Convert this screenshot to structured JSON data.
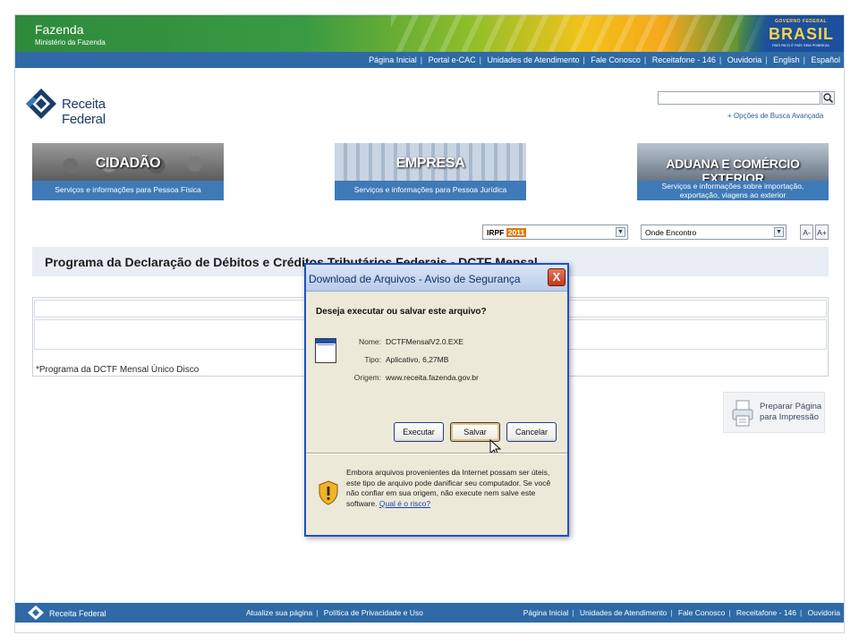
{
  "header": {
    "org_title": "Fazenda",
    "org_subtitle": "Ministério da Fazenda",
    "brasil_top": "GOVERNO FEDERAL",
    "brasil_word": "BRASIL",
    "brasil_bottom": "PAÍS RICO É PAÍS SEM POBREZA"
  },
  "topnav": {
    "items": [
      "Página Inicial",
      "Portal e-CAC",
      "Unidades de Atendimento",
      "Fale Conosco",
      "Receitafone - 146",
      "Ouvidoria",
      "English",
      "Español"
    ]
  },
  "logo": {
    "text": "Receita Federal"
  },
  "search": {
    "value": "",
    "advanced_link": "+ Opções de Busca Avançada"
  },
  "categories": [
    {
      "title": "CIDADÃO",
      "line1": "Serviços e informações para Pessoa Física",
      "line2": ""
    },
    {
      "title": "EMPRESA",
      "line1": "Serviços e informações para Pessoa Jurídica",
      "line2": ""
    },
    {
      "title": "ADUANA E COMÉRCIO EXTERIOR",
      "line1": "Serviços e informações sobre importação,",
      "line2": "exportação, viagens ao exterior"
    }
  ],
  "selects": {
    "irpf_label": "IRPF",
    "irpf_year": "2011",
    "where": "Onde Encontro"
  },
  "font_buttons": {
    "decrease": "A-",
    "increase": "A+"
  },
  "page": {
    "title": "Programa da Declaração de Débitos e Créditos Tributários Federais - DCTF Mensal",
    "row_link": "*Programa da DCTF Mensal Único Disco"
  },
  "print": {
    "line1": "Preparar Página",
    "line2": "para Impressão"
  },
  "footer": {
    "logo_text": "Receita Federal",
    "mid_items": [
      "Atualize sua página",
      "Política de Privacidade e Uso"
    ],
    "right_items": [
      "Página Inicial",
      "Unidades de Atendimento",
      "Fale Conosco",
      "Receitafone - 146",
      "Ouvidoria"
    ]
  },
  "dialog": {
    "title": "Download de Arquivos - Aviso de Segurança",
    "close": "X",
    "question": "Deseja executar ou salvar este arquivo?",
    "name_label": "Nome:",
    "name_value": "DCTFMensalV2.0.EXE",
    "type_label": "Tipo:",
    "type_value": "Aplicativo, 6,27MB",
    "origin_label": "Origem:",
    "origin_value": "www.receita.fazenda.gov.br",
    "btn_run": "Executar",
    "btn_save": "Salvar",
    "btn_cancel": "Cancelar",
    "warning_text": "Embora arquivos provenientes da Internet possam ser úteis, este tipo de arquivo pode danificar seu computador. Se você não confiar em sua origem, não execute nem salve este software.",
    "warning_link": "Qual é o risco?"
  },
  "colors": {
    "nav_blue": "#2f6aa6",
    "dialog_border": "#1c52c8",
    "dialog_bg": "#ece9d8"
  }
}
